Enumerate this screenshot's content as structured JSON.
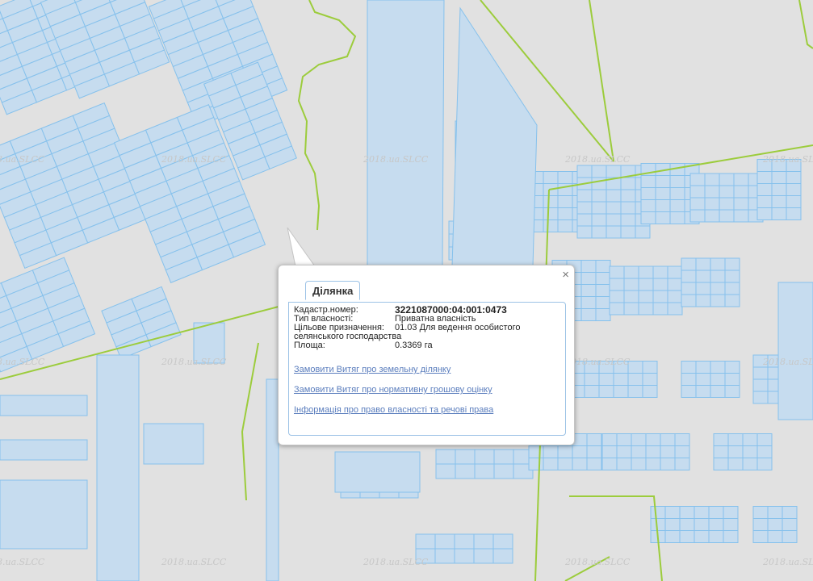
{
  "map": {
    "watermark": "2018.ua.SLCC",
    "colors": {
      "background": "#e1e1e1",
      "parcel_fill": "#c6dcef",
      "parcel_stroke": "#86c1ec",
      "boundary": "#9ccc3c"
    }
  },
  "popup": {
    "tab_label": "Ділянка",
    "close_label": "×",
    "fields": [
      {
        "label": "Кадастр.номер:",
        "value": "3221087000:04:001:0473"
      },
      {
        "label": "Тип власності:",
        "value": "Приватна власність"
      },
      {
        "label": "Цільове призначення:",
        "value": "01.03 Для ведення особистого"
      },
      {
        "label": "",
        "value": "селянського господарства"
      },
      {
        "label": "Площа:",
        "value": "0.3369 га"
      }
    ],
    "links": [
      "Замовити Витяг про земельну ділянку",
      "Замовити Витяг про нормативну грошову оцінку",
      "Інформація про право власності та речові права"
    ]
  }
}
